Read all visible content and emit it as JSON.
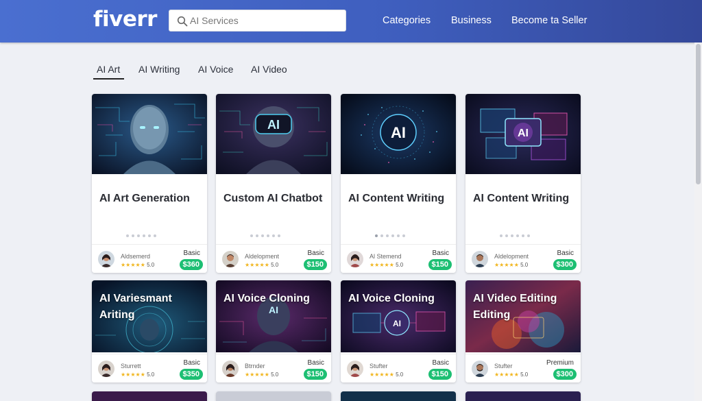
{
  "header": {
    "logo": "fiverr",
    "search_placeholder": "AI Services",
    "nav": [
      "Categories",
      "Business",
      "Become ta Seller"
    ]
  },
  "tabs": [
    "AI Art",
    "AI Writing",
    "AI Voice",
    "AI Video"
  ],
  "active_tab": "AI Art",
  "colors": {
    "accent": "#1dbf73",
    "header": "#3f5fbf",
    "star": "#f1b51c"
  },
  "cards": [
    {
      "title": "AI Art Generation",
      "thumb_label": "",
      "seller": "Aldsemerd",
      "rating": "5.0",
      "tier": "Basic",
      "price": "$360"
    },
    {
      "title": "Custom AI Chatbot",
      "thumb_label": "AI",
      "seller": "Aldelopment",
      "rating": "5.0",
      "tier": "Basic",
      "price": "$150"
    },
    {
      "title": "AI Content Writing",
      "thumb_label": "AI",
      "seller": "Al Stemend",
      "rating": "5.0",
      "tier": "Basic",
      "price": "$150"
    },
    {
      "title": "AI Content Writing",
      "thumb_label": "AI",
      "seller": "Aldelopment",
      "rating": "5.0",
      "tier": "Basic",
      "price": "$300"
    },
    {
      "title": "AI Variesmant Ariting",
      "thumb_label": "",
      "seller": "Sturrett",
      "rating": "5.0",
      "tier": "Basic",
      "price": "$350"
    },
    {
      "title": "AI Voice Cloning",
      "thumb_label": "AI",
      "seller": "Btrnder",
      "rating": "5.0",
      "tier": "Basic",
      "price": "$150"
    },
    {
      "title": "AI Voice Cloning",
      "thumb_label": "AI",
      "seller": "Stufter",
      "rating": "5.0",
      "tier": "Basic",
      "price": "$150"
    },
    {
      "title": "AI Video Editing Editing",
      "thumb_label": "",
      "seller": "Stufter",
      "rating": "5.0",
      "tier": "Premium",
      "price": "$300"
    }
  ],
  "stars": "★★★★★"
}
